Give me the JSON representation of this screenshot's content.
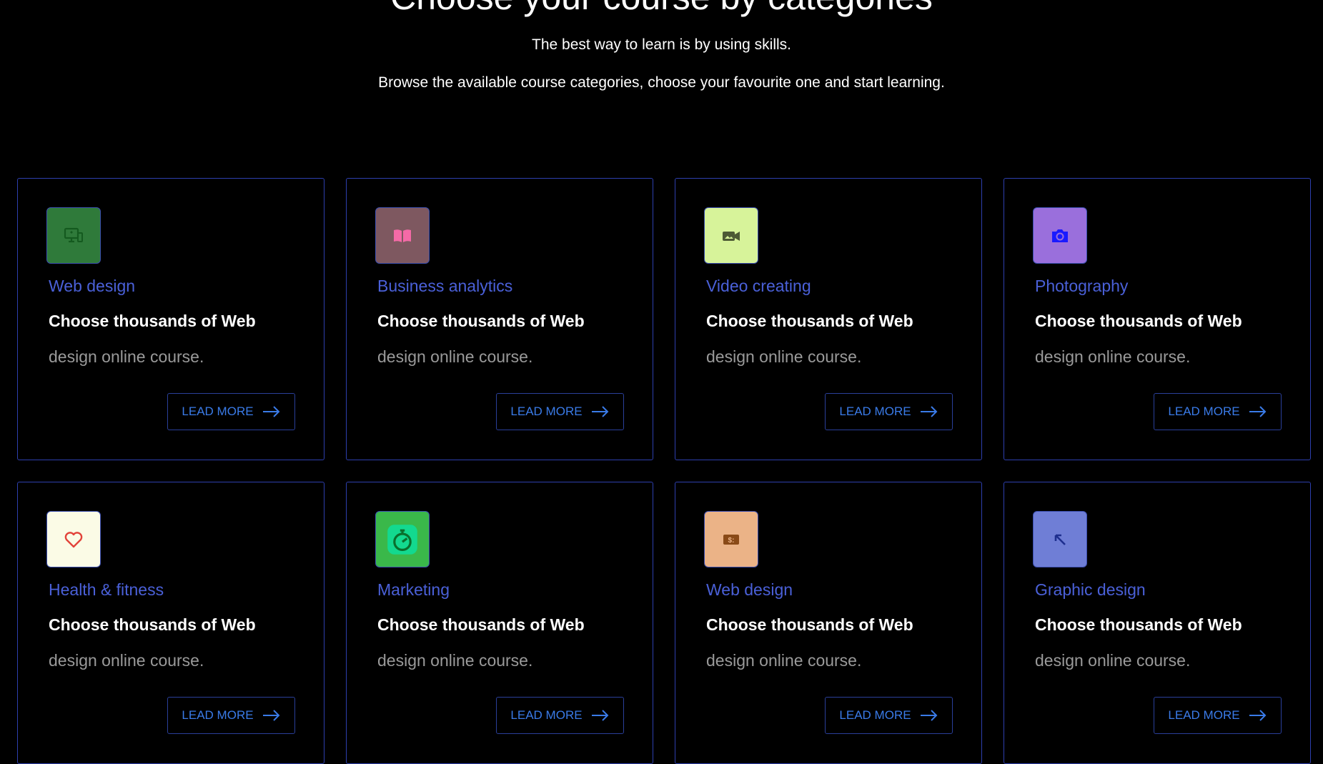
{
  "header": {
    "title": "Choose your course by categories",
    "subtitle1": "The best way to learn is by using skills.",
    "subtitle2": "Browse the available course categories, choose your favourite one and start learning."
  },
  "cards": [
    {
      "category": "Web design",
      "line1": "Choose thousands of Web",
      "line2": "design online course.",
      "button": "LEAD MORE",
      "icon": "monitor-devices-icon",
      "icon_bg": "#2f7a3a",
      "icon_color": "#1f5a25"
    },
    {
      "category": "Business analytics",
      "line1": "Choose thousands of Web",
      "line2": "design online course.",
      "button": "LEAD MORE",
      "icon": "book-icon",
      "icon_bg": "#7e5860",
      "icon_color": "#f56aa7"
    },
    {
      "category": "Video creating",
      "line1": "Choose thousands of Web",
      "line2": "design online course.",
      "button": "LEAD MORE",
      "icon": "video-camera-icon",
      "icon_bg": "#d7f39a",
      "icon_color": "#4d5a35"
    },
    {
      "category": "Photography",
      "line1": "Choose thousands of Web",
      "line2": "design online course.",
      "button": "LEAD MORE",
      "icon": "camera-icon",
      "icon_bg": "#9a6fdc",
      "icon_color": "#1a1aff"
    },
    {
      "category": "Health & fitness",
      "line1": "Choose thousands of Web",
      "line2": "design online course.",
      "button": "LEAD MORE",
      "icon": "heart-icon",
      "icon_bg": "#fbfbe6",
      "icon_color": "#e2433a"
    },
    {
      "category": "Marketing",
      "line1": "Choose thousands of Web",
      "line2": "design online course.",
      "button": "LEAD MORE",
      "icon": "stopwatch-icon",
      "icon_bg": "#3ab84a",
      "icon_color": "#0a8f3a"
    },
    {
      "category": "Web design",
      "line1": "Choose thousands of Web",
      "line2": "design online course.",
      "button": "LEAD MORE",
      "icon": "money-icon",
      "icon_bg": "#ebb387",
      "icon_color": "#8a4a17"
    },
    {
      "category": "Graphic design",
      "line1": "Choose thousands of Web",
      "line2": "design online course.",
      "button": "LEAD MORE",
      "icon": "arrow-up-left-icon",
      "icon_bg": "#6f7ed6",
      "icon_color": "#1e2f8f"
    }
  ]
}
